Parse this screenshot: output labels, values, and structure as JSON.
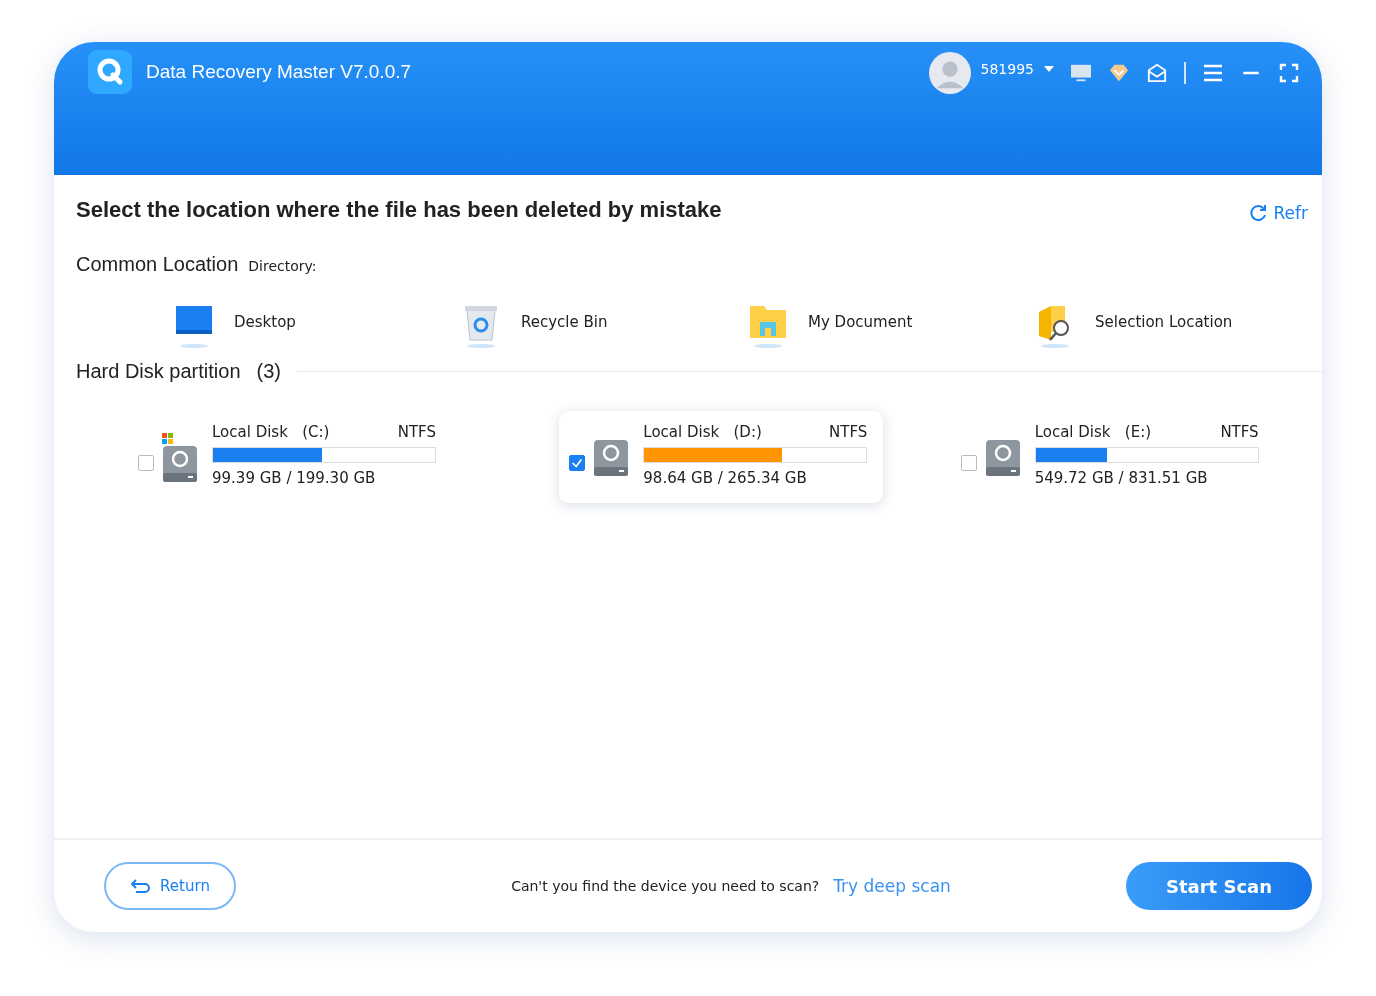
{
  "window": {
    "title": "Data Recovery Master V7.0.0.7",
    "user_id": "581995"
  },
  "heading": "Select the location where the file has been deleted by mistake",
  "refresh": "Refr",
  "common": {
    "title": "Common Location",
    "directory_label": "Directory:",
    "items": [
      {
        "kind": "desktop",
        "label": "Desktop"
      },
      {
        "kind": "recycle",
        "label": "Recycle Bin"
      },
      {
        "kind": "documents",
        "label": "My Document"
      },
      {
        "kind": "select",
        "label": "Selection Location"
      }
    ]
  },
  "partitions": {
    "title": "Hard Disk partition",
    "count": "(3)",
    "disks": [
      {
        "name": "Local Disk",
        "letter": "(C:)",
        "fs": "NTFS",
        "size": "99.39 GB / 199.30 GB",
        "level": 0.49,
        "system": true,
        "selected": false,
        "color": "#1a7ff0"
      },
      {
        "name": "Local Disk",
        "letter": "(D:)",
        "fs": "NTFS",
        "size": "98.64 GB / 265.34 GB",
        "level": 0.62,
        "system": false,
        "selected": true,
        "color": "#ff9500"
      },
      {
        "name": "Local Disk",
        "letter": "(E:)",
        "fs": "NTFS",
        "size": "549.72 GB / 831.51 GB",
        "level": 0.32,
        "system": false,
        "selected": false,
        "color": "#1a7ff0"
      }
    ]
  },
  "footer": {
    "return": "Return",
    "question": "Can't you find the device you need to scan?",
    "link": "Try deep scan",
    "start": "Start Scan"
  }
}
